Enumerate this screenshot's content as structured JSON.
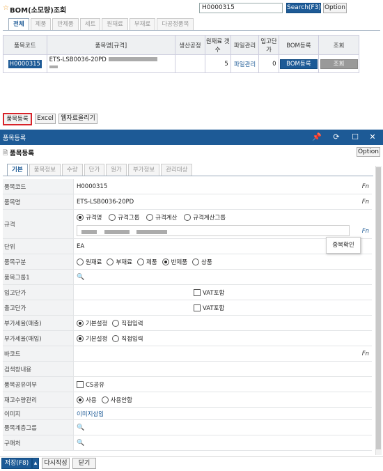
{
  "top_window": {
    "title": "BOM(소모량)조회",
    "search_value": "H0000315",
    "search_button": "Search(F3)",
    "option_button": "Option",
    "tabs": [
      "전체",
      "제품",
      "반제품",
      "세트",
      "원재료",
      "부재료",
      "다공정품목"
    ],
    "table": {
      "headers": [
        "품목코드",
        "품목명[규격]",
        "생산공정",
        "원재료 갯수",
        "파일관리",
        "입고단가",
        "BOM등록",
        "조회"
      ],
      "rows": [
        {
          "code": "H0000315",
          "name": "ETS-LSB0036-20PD",
          "process": "",
          "material_count": "5",
          "file": "파일관리",
          "price": "0",
          "bom": "BOM등록",
          "view": "조회"
        }
      ]
    },
    "bottom_buttons": {
      "register": "품목등록",
      "excel": "Excel",
      "web_upload": "웹자료올리기"
    }
  },
  "dialog": {
    "title": "품목등록",
    "subtitle": "품목등록",
    "option_button": "Option",
    "tabs": [
      "기본",
      "품목정보",
      "수량",
      "단가",
      "원가",
      "부가정보",
      "관리대상"
    ],
    "fields": {
      "item_code": {
        "label": "품목코드",
        "value": "H0000315",
        "fn": "Fn"
      },
      "item_name": {
        "label": "품목명",
        "value": "ETS-LSB0036-20PD",
        "fn": "Fn"
      },
      "spec": {
        "label": "규격",
        "options": [
          "규격명",
          "규격그룹",
          "규격계산",
          "규격계산그룹"
        ],
        "fn": "Fn",
        "dup_check": "중복확인"
      },
      "unit": {
        "label": "단위",
        "value": "EA"
      },
      "item_type": {
        "label": "품목구분",
        "options": [
          "원재료",
          "부재료",
          "제품",
          "반제품",
          "상품"
        ]
      },
      "item_group1": {
        "label": "품목그룹1"
      },
      "in_price": {
        "label": "입고단가",
        "vat": "VAT포함"
      },
      "out_price": {
        "label": "출고단가",
        "vat": "VAT포함"
      },
      "vat_sales": {
        "label": "부가세율(매출)",
        "options": [
          "기본설정",
          "직접입력"
        ]
      },
      "vat_purchase": {
        "label": "부가세율(매입)",
        "options": [
          "기본설정",
          "직접입력"
        ]
      },
      "barcode": {
        "label": "바코드",
        "fn": "Fn"
      },
      "search_text": {
        "label": "검색창내용"
      },
      "share": {
        "label": "품목공유여부",
        "option": "CS공유"
      },
      "stock_mgmt": {
        "label": "재고수량관리",
        "options": [
          "사용",
          "사용안함"
        ]
      },
      "image": {
        "label": "이미지",
        "link": "이미지삽입"
      },
      "hierarchy_group": {
        "label": "품목계층그룹"
      },
      "purchase_place": {
        "label": "구매처"
      }
    },
    "footer": {
      "save": "저장(F8)",
      "rewrite": "다시작성",
      "close": "닫기"
    }
  }
}
